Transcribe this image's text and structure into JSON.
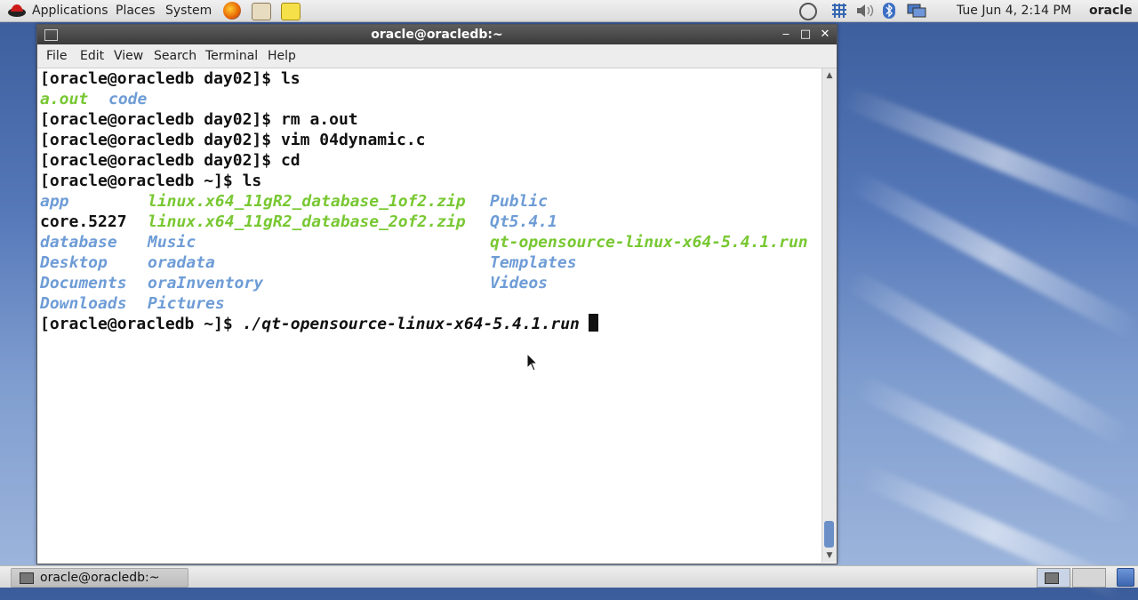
{
  "top_panel": {
    "menus": [
      "Applications",
      "Places",
      "System"
    ],
    "launchers": [
      "firefox-icon",
      "mail-icon",
      "notes-icon"
    ],
    "tray_icons": [
      "update-icon",
      "network-icon",
      "volume-icon",
      "bluetooth-icon",
      "display-icon"
    ],
    "clock": "Tue Jun  4,  2:14 PM",
    "user": "oracle"
  },
  "window": {
    "title": "oracle@oracledb:~",
    "controls": {
      "minimize": "‒",
      "maximize": "□",
      "close": "✕"
    },
    "menubar": [
      "File",
      "Edit",
      "View",
      "Search",
      "Terminal",
      "Help"
    ]
  },
  "terminal": {
    "prompt_day02": "[oracle@oracledb day02]$ ",
    "prompt_home": "[oracle@oracledb ~]$ ",
    "cmd_ls1": "ls",
    "out1": [
      "a.out",
      "code"
    ],
    "cmd_rm": "rm a.out",
    "cmd_vim": "vim 04dynamic.c",
    "cmd_cd": "cd",
    "cmd_ls2": "ls",
    "listing": {
      "col1": [
        "app",
        "core.5227",
        "database",
        "Desktop",
        "Documents",
        "Downloads"
      ],
      "col2": [
        "linux.x64_11gR2_database_1of2.zip",
        "linux.x64_11gR2_database_2of2.zip",
        "Music",
        "oradata",
        "oraInventory",
        "Pictures"
      ],
      "col3": [
        "Public",
        "Qt5.4.1",
        "qt-opensource-linux-x64-5.4.1.run",
        "Templates",
        "Videos"
      ]
    },
    "current_cmd": "./qt-opensource-linux-x64-5.4.1.run"
  },
  "taskbar": {
    "task_label": "oracle@oracledb:~"
  }
}
